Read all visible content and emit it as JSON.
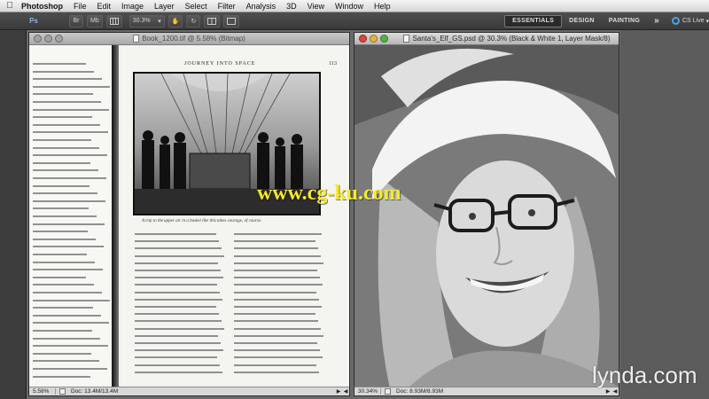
{
  "menubar": {
    "app_name": "Photoshop",
    "items": [
      "File",
      "Edit",
      "Image",
      "Layer",
      "Select",
      "Filter",
      "Analysis",
      "3D",
      "View",
      "Window",
      "Help"
    ]
  },
  "optionsbar": {
    "ps_label": "Ps",
    "br_label": "Br",
    "mb_label": "Mb",
    "zoom_value": "30.3%",
    "workspaces": [
      "ESSENTIALS",
      "DESIGN",
      "PAINTING"
    ],
    "more_label": "»",
    "cs_live_label": "CS Live"
  },
  "doc_left": {
    "title": "Book_1200.tif @ 5.58% (Bitmap)",
    "running_head": "JOURNEY INTO SPACE",
    "page_number": "113",
    "caption": "A trip to the upper air in a basket like this takes courage, of course.",
    "status_zoom": "5.58%",
    "status_doc": "Doc: 13.4M/13.4M"
  },
  "doc_right": {
    "title": "Santa's_Elf_GS.psd @ 30.3% (Black & White 1, Layer Mask/8)",
    "status_zoom": "30.34%",
    "status_doc": "Doc: 8.93M/8.93M"
  },
  "overlay": {
    "watermark": "www.cg-ku.com",
    "brand": "lynda.com"
  },
  "colors": {
    "watermark": "#f6ea2a",
    "traffic_red": "#e0443c",
    "traffic_yellow": "#e6b23a",
    "traffic_green": "#4fb443"
  }
}
